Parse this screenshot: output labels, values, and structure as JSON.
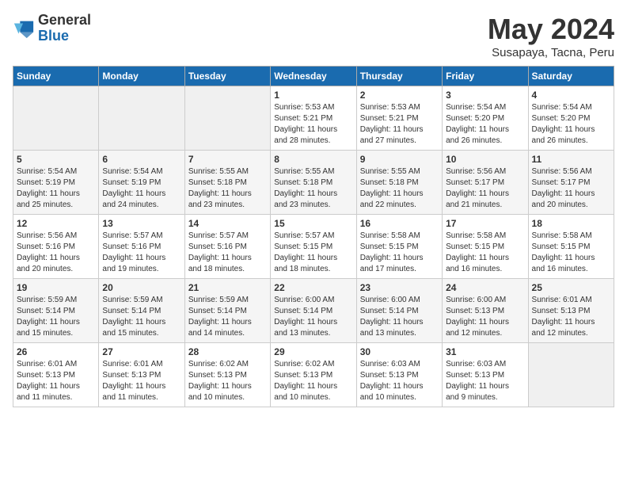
{
  "logo": {
    "general": "General",
    "blue": "Blue"
  },
  "title": "May 2024",
  "subtitle": "Susapaya, Tacna, Peru",
  "days_of_week": [
    "Sunday",
    "Monday",
    "Tuesday",
    "Wednesday",
    "Thursday",
    "Friday",
    "Saturday"
  ],
  "weeks": [
    [
      {
        "num": "",
        "info": ""
      },
      {
        "num": "",
        "info": ""
      },
      {
        "num": "",
        "info": ""
      },
      {
        "num": "1",
        "info": "Sunrise: 5:53 AM\nSunset: 5:21 PM\nDaylight: 11 hours\nand 28 minutes."
      },
      {
        "num": "2",
        "info": "Sunrise: 5:53 AM\nSunset: 5:21 PM\nDaylight: 11 hours\nand 27 minutes."
      },
      {
        "num": "3",
        "info": "Sunrise: 5:54 AM\nSunset: 5:20 PM\nDaylight: 11 hours\nand 26 minutes."
      },
      {
        "num": "4",
        "info": "Sunrise: 5:54 AM\nSunset: 5:20 PM\nDaylight: 11 hours\nand 26 minutes."
      }
    ],
    [
      {
        "num": "5",
        "info": "Sunrise: 5:54 AM\nSunset: 5:19 PM\nDaylight: 11 hours\nand 25 minutes."
      },
      {
        "num": "6",
        "info": "Sunrise: 5:54 AM\nSunset: 5:19 PM\nDaylight: 11 hours\nand 24 minutes."
      },
      {
        "num": "7",
        "info": "Sunrise: 5:55 AM\nSunset: 5:18 PM\nDaylight: 11 hours\nand 23 minutes."
      },
      {
        "num": "8",
        "info": "Sunrise: 5:55 AM\nSunset: 5:18 PM\nDaylight: 11 hours\nand 23 minutes."
      },
      {
        "num": "9",
        "info": "Sunrise: 5:55 AM\nSunset: 5:18 PM\nDaylight: 11 hours\nand 22 minutes."
      },
      {
        "num": "10",
        "info": "Sunrise: 5:56 AM\nSunset: 5:17 PM\nDaylight: 11 hours\nand 21 minutes."
      },
      {
        "num": "11",
        "info": "Sunrise: 5:56 AM\nSunset: 5:17 PM\nDaylight: 11 hours\nand 20 minutes."
      }
    ],
    [
      {
        "num": "12",
        "info": "Sunrise: 5:56 AM\nSunset: 5:16 PM\nDaylight: 11 hours\nand 20 minutes."
      },
      {
        "num": "13",
        "info": "Sunrise: 5:57 AM\nSunset: 5:16 PM\nDaylight: 11 hours\nand 19 minutes."
      },
      {
        "num": "14",
        "info": "Sunrise: 5:57 AM\nSunset: 5:16 PM\nDaylight: 11 hours\nand 18 minutes."
      },
      {
        "num": "15",
        "info": "Sunrise: 5:57 AM\nSunset: 5:15 PM\nDaylight: 11 hours\nand 18 minutes."
      },
      {
        "num": "16",
        "info": "Sunrise: 5:58 AM\nSunset: 5:15 PM\nDaylight: 11 hours\nand 17 minutes."
      },
      {
        "num": "17",
        "info": "Sunrise: 5:58 AM\nSunset: 5:15 PM\nDaylight: 11 hours\nand 16 minutes."
      },
      {
        "num": "18",
        "info": "Sunrise: 5:58 AM\nSunset: 5:15 PM\nDaylight: 11 hours\nand 16 minutes."
      }
    ],
    [
      {
        "num": "19",
        "info": "Sunrise: 5:59 AM\nSunset: 5:14 PM\nDaylight: 11 hours\nand 15 minutes."
      },
      {
        "num": "20",
        "info": "Sunrise: 5:59 AM\nSunset: 5:14 PM\nDaylight: 11 hours\nand 15 minutes."
      },
      {
        "num": "21",
        "info": "Sunrise: 5:59 AM\nSunset: 5:14 PM\nDaylight: 11 hours\nand 14 minutes."
      },
      {
        "num": "22",
        "info": "Sunrise: 6:00 AM\nSunset: 5:14 PM\nDaylight: 11 hours\nand 13 minutes."
      },
      {
        "num": "23",
        "info": "Sunrise: 6:00 AM\nSunset: 5:14 PM\nDaylight: 11 hours\nand 13 minutes."
      },
      {
        "num": "24",
        "info": "Sunrise: 6:00 AM\nSunset: 5:13 PM\nDaylight: 11 hours\nand 12 minutes."
      },
      {
        "num": "25",
        "info": "Sunrise: 6:01 AM\nSunset: 5:13 PM\nDaylight: 11 hours\nand 12 minutes."
      }
    ],
    [
      {
        "num": "26",
        "info": "Sunrise: 6:01 AM\nSunset: 5:13 PM\nDaylight: 11 hours\nand 11 minutes."
      },
      {
        "num": "27",
        "info": "Sunrise: 6:01 AM\nSunset: 5:13 PM\nDaylight: 11 hours\nand 11 minutes."
      },
      {
        "num": "28",
        "info": "Sunrise: 6:02 AM\nSunset: 5:13 PM\nDaylight: 11 hours\nand 10 minutes."
      },
      {
        "num": "29",
        "info": "Sunrise: 6:02 AM\nSunset: 5:13 PM\nDaylight: 11 hours\nand 10 minutes."
      },
      {
        "num": "30",
        "info": "Sunrise: 6:03 AM\nSunset: 5:13 PM\nDaylight: 11 hours\nand 10 minutes."
      },
      {
        "num": "31",
        "info": "Sunrise: 6:03 AM\nSunset: 5:13 PM\nDaylight: 11 hours\nand 9 minutes."
      },
      {
        "num": "",
        "info": ""
      }
    ]
  ]
}
